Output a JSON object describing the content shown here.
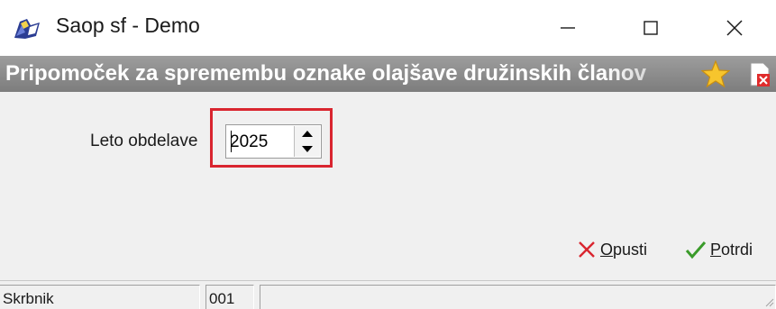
{
  "window": {
    "title": "Saop sf - Demo",
    "icons": {
      "app": "saop-app-icon",
      "minimize": "minimize-icon",
      "maximize": "maximize-icon",
      "close": "close-icon"
    }
  },
  "header": {
    "title": "Pripomoček za spremembu oznake olajšave družinskih članov",
    "icons": {
      "favorite": "star-icon",
      "report": "document-close-icon"
    }
  },
  "form": {
    "year_label": "Leto obdelave",
    "year_value": "2025",
    "spinner_icons": {
      "up": "arrow-up-icon",
      "down": "arrow-down-icon"
    }
  },
  "actions": {
    "cancel": {
      "mnemonic": "O",
      "rest": "pusti",
      "icon": "x-mark-icon",
      "color": "#d9252f"
    },
    "confirm": {
      "mnemonic": "P",
      "rest": "otrdi",
      "icon": "check-mark-icon",
      "color": "#3a9b2a"
    }
  },
  "statusbar": {
    "user": "Skrbnik",
    "code": "001",
    "extra": ""
  },
  "colors": {
    "highlight": "#d9252f",
    "header_bg": "#8a8a8a"
  }
}
